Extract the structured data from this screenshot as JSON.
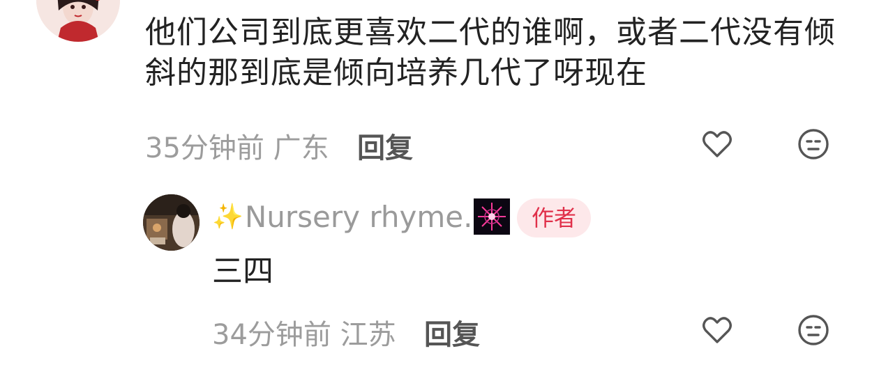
{
  "comment": {
    "text": "他们公司到底更喜欢二代的谁啊，或者二代没有倾斜的那到底是倾向培养几代了呀现在",
    "time": "35分钟前",
    "location": "广东",
    "reply_label": "回复",
    "like_icon": "heart-outline-icon",
    "dislike_icon": "meh-face-icon"
  },
  "reply": {
    "username_sparkle": "✨",
    "username": "Nursery rhyme.",
    "badge": "作者",
    "text": "三四",
    "time": "34分钟前",
    "location": "江苏",
    "reply_label": "回复",
    "like_icon": "heart-outline-icon",
    "dislike_icon": "meh-face-icon"
  },
  "colors": {
    "meta_gray": "#9c9c9c",
    "badge_bg": "#fde8ea",
    "badge_text": "#e0304a"
  }
}
